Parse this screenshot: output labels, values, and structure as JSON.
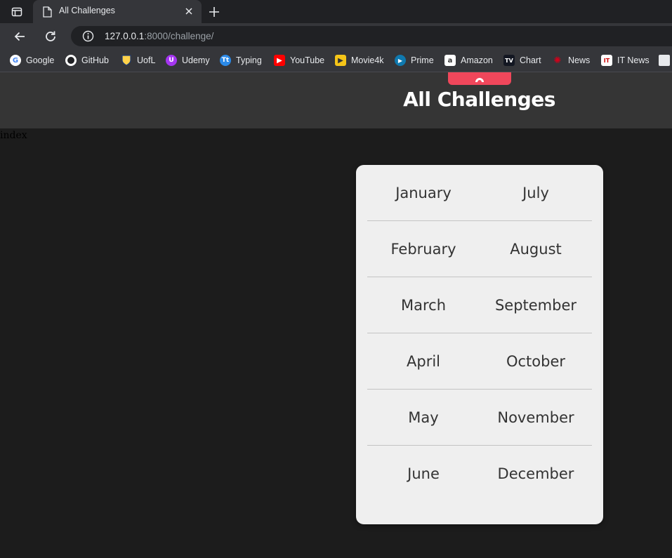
{
  "browser": {
    "tab": {
      "title": "All Challenges"
    },
    "address": {
      "host": "127.0.0.1",
      "rest": ":8000/challenge/"
    },
    "bookmarks": [
      {
        "label": "Google",
        "icon": "google-icon",
        "color": "#ffffff",
        "glyph": "G"
      },
      {
        "label": "GitHub",
        "icon": "github-icon",
        "color": "#ffffff",
        "glyph": ""
      },
      {
        "label": "UofL",
        "icon": "shield-icon",
        "color": "#1f3b73",
        "glyph": ""
      },
      {
        "label": "Udemy",
        "icon": "udemy-icon",
        "color": "#a435f0",
        "glyph": "U"
      },
      {
        "label": "Typing",
        "icon": "typing-icon",
        "color": "#2b8ae8",
        "glyph": "Tt"
      },
      {
        "label": "YouTube",
        "icon": "youtube-icon",
        "color": "#ff0000",
        "glyph": "▶"
      },
      {
        "label": "Movie4k",
        "icon": "play-icon",
        "color": "#f5c518",
        "glyph": "▶"
      },
      {
        "label": "Prime",
        "icon": "prime-icon",
        "color": "#1a98ff",
        "glyph": "▶"
      },
      {
        "label": "Amazon",
        "icon": "amazon-icon",
        "color": "#ffffff",
        "glyph": "a"
      },
      {
        "label": "Chart",
        "icon": "tradingview-icon",
        "color": "#131722",
        "glyph": "TV"
      },
      {
        "label": "News",
        "icon": "cbc-icon",
        "color": "#d0021b",
        "glyph": "✺"
      },
      {
        "label": "IT News",
        "icon": "itnews-icon",
        "color": "#ffffff",
        "glyph": "IT"
      }
    ]
  },
  "page": {
    "title": "All Challenges",
    "index_text": "index",
    "accent": "#f0475b",
    "months_left": [
      "January",
      "February",
      "March",
      "April",
      "May",
      "June"
    ],
    "months_right": [
      "July",
      "August",
      "September",
      "October",
      "November",
      "December"
    ]
  }
}
